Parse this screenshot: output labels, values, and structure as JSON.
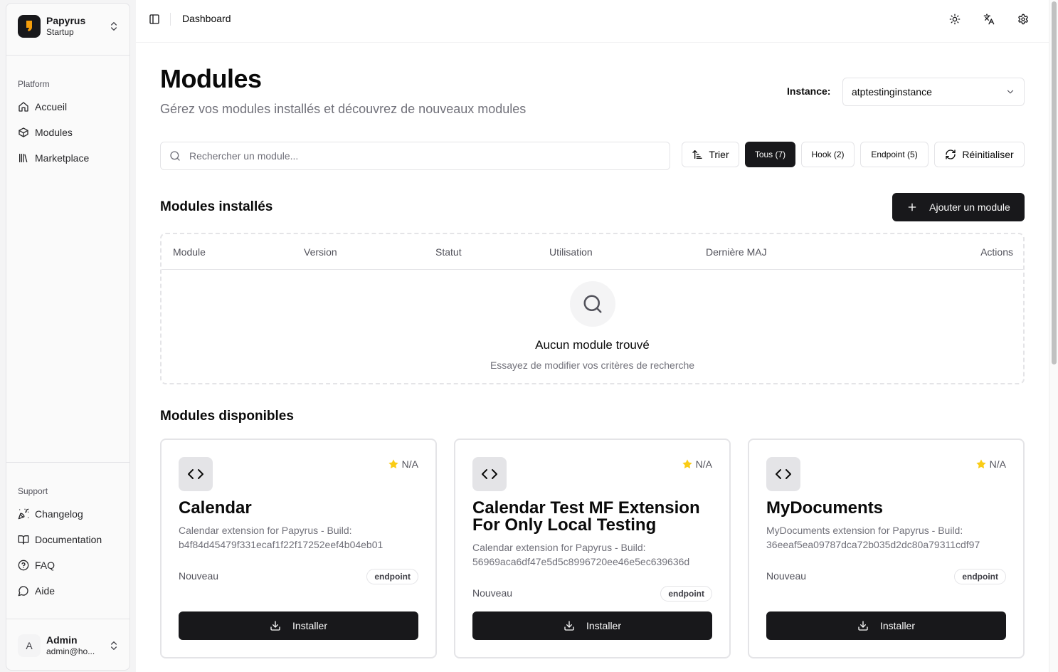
{
  "team": {
    "name": "Papyrus",
    "plan": "Startup"
  },
  "sidebar": {
    "platform_label": "Platform",
    "platform_items": [
      {
        "label": "Accueil",
        "icon": "home-icon"
      },
      {
        "label": "Modules",
        "icon": "package-icon"
      },
      {
        "label": "Marketplace",
        "icon": "library-icon"
      }
    ],
    "support_label": "Support",
    "support_items": [
      {
        "label": "Changelog",
        "icon": "party-popper-icon"
      },
      {
        "label": "Documentation",
        "icon": "book-open-icon"
      },
      {
        "label": "FAQ",
        "icon": "help-circle-icon"
      },
      {
        "label": "Aide",
        "icon": "message-circle-icon"
      }
    ]
  },
  "user": {
    "initial": "A",
    "name": "Admin",
    "email": "admin@ho..."
  },
  "topbar": {
    "breadcrumb": "Dashboard"
  },
  "page": {
    "title": "Modules",
    "subtitle": "Gérez vos modules installés et découvrez de nouveaux modules",
    "instance_label": "Instance:",
    "instance_value": "atptestinginstance"
  },
  "search": {
    "placeholder": "Rechercher un module...",
    "value": ""
  },
  "toolbar": {
    "sort_label": "Trier",
    "filters": [
      "Tous (7)",
      "Hook (2)",
      "Endpoint (5)"
    ],
    "active_filter": "Tous (7)",
    "reset_label": "Réinitialiser"
  },
  "installed": {
    "title": "Modules installés",
    "add_label": "Ajouter un module",
    "columns": [
      "Module",
      "Version",
      "Statut",
      "Utilisation",
      "Dernière MAJ",
      "Actions"
    ],
    "empty_title": "Aucun module trouvé",
    "empty_subtitle": "Essayez de modifier vos critères de recherche"
  },
  "available": {
    "title": "Modules disponibles",
    "cards": [
      {
        "title": "Calendar",
        "rating": "N/A",
        "description": "Calendar extension for Papyrus - Build: b4f84d45479f331ecaf1f22f17252eef4b04eb01",
        "status": "Nouveau",
        "badge": "endpoint",
        "install_label": "Installer"
      },
      {
        "title": "Calendar Test MF Extension For Only Local Testing",
        "rating": "N/A",
        "description": "Calendar extension for Papyrus - Build: 56969aca6df47e5d5c8996720ee46e5ec639636d",
        "status": "Nouveau",
        "badge": "endpoint",
        "install_label": "Installer"
      },
      {
        "title": "MyDocuments",
        "rating": "N/A",
        "description": "MyDocuments extension for Papyrus - Build: 36eeaf5ea09787dca72b035d2dc80a79311cdf97",
        "status": "Nouveau",
        "badge": "endpoint",
        "install_label": "Installer"
      }
    ]
  },
  "colors": {
    "primary": "#18181b",
    "star": "#facc15",
    "muted": "#71717a",
    "border": "#e4e4e7"
  }
}
